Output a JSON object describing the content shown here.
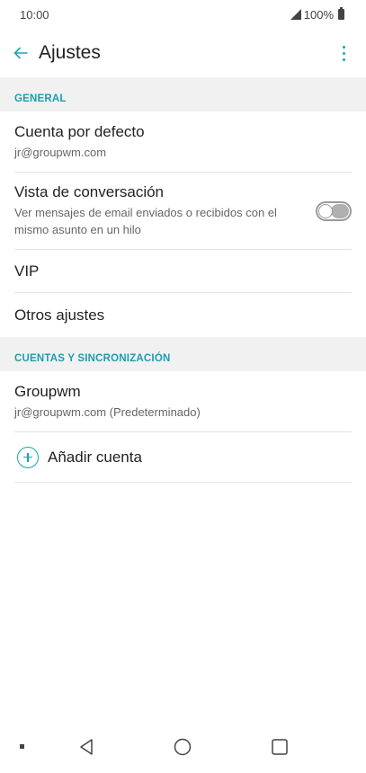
{
  "status_bar": {
    "time": "10:00",
    "battery": "100%"
  },
  "header": {
    "title": "Ajustes",
    "back_icon": "arrow-left-icon",
    "menu_icon": "more-vert-icon"
  },
  "sections": [
    {
      "header": "GENERAL",
      "items": [
        {
          "title": "Cuenta por defecto",
          "subtitle": "jr@groupwm.com"
        },
        {
          "title": "Vista de conversación",
          "subtitle": "Ver mensajes de email enviados o recibidos con el mismo asunto en un hilo",
          "toggle_on": false
        },
        {
          "title": "VIP"
        },
        {
          "title": "Otros ajustes"
        }
      ]
    },
    {
      "header": "CUENTAS Y SINCRONIZACIÓN",
      "items": [
        {
          "title": "Groupwm",
          "subtitle": "jr@groupwm.com (Predeterminado)"
        },
        {
          "title": "Añadir cuenta",
          "icon": "add-circle-icon"
        }
      ]
    }
  ],
  "nav_bar": {
    "icons": [
      "dot-icon",
      "back-triangle-icon",
      "home-circle-icon",
      "recents-square-icon"
    ]
  },
  "colors": {
    "accent": "#1aa3b3",
    "section_bg": "#f1f1f1"
  }
}
